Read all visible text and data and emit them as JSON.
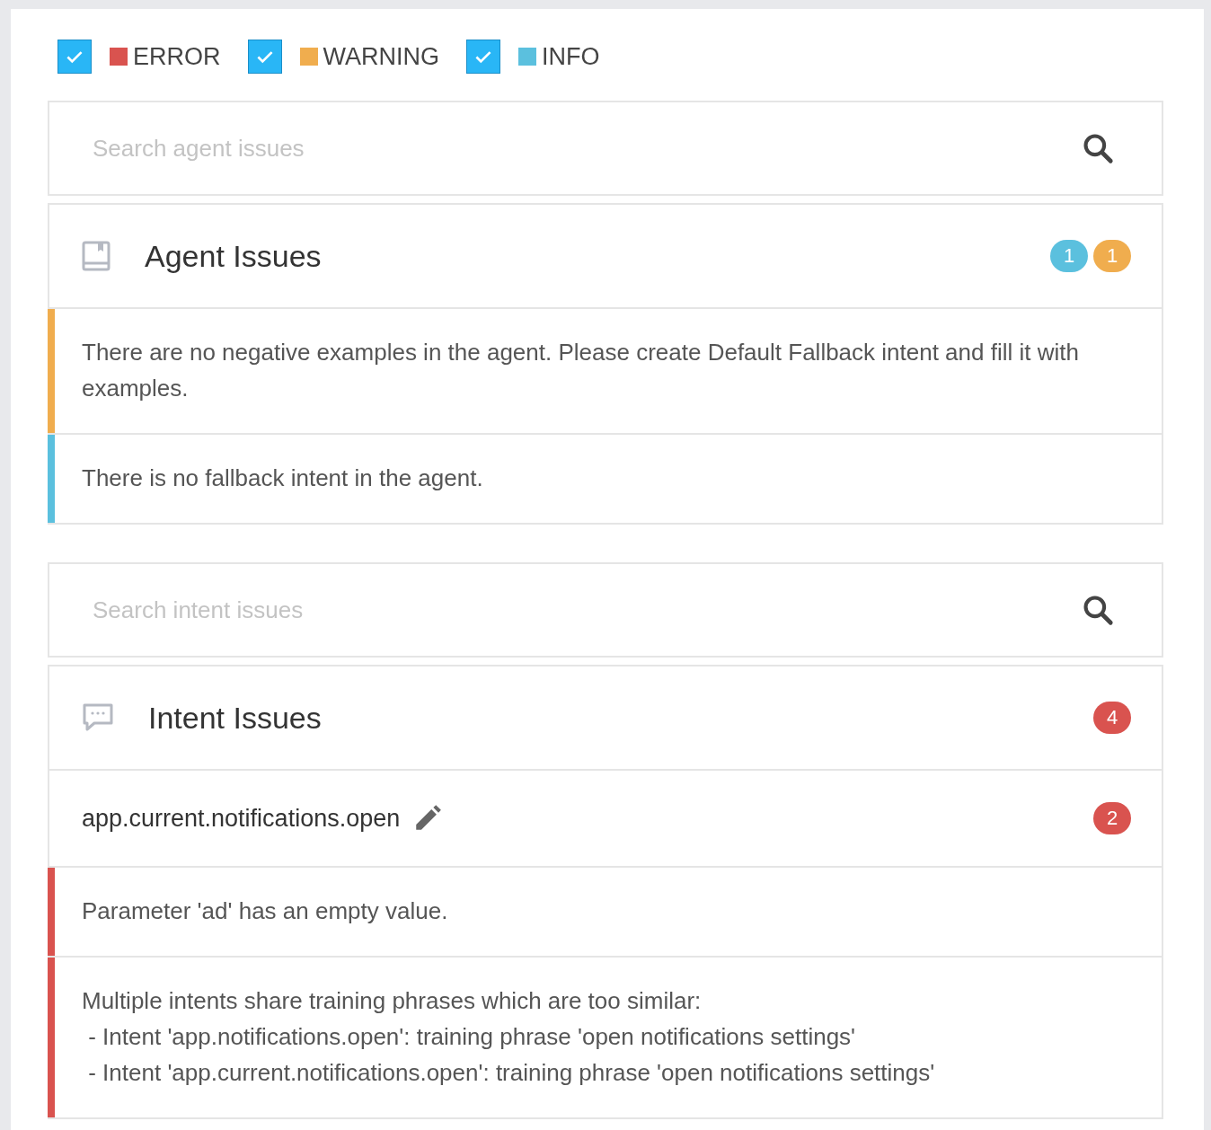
{
  "filters": [
    {
      "label": "ERROR",
      "checked": true,
      "color": "#d9534f"
    },
    {
      "label": "WARNING",
      "checked": true,
      "color": "#f0ad4e"
    },
    {
      "label": "INFO",
      "checked": true,
      "color": "#5bc0de"
    }
  ],
  "agent_search": {
    "placeholder": "Search agent issues"
  },
  "agent_section": {
    "title": "Agent Issues",
    "badges": [
      {
        "count": "1",
        "color": "#5bc0de"
      },
      {
        "count": "1",
        "color": "#f0ad4e"
      }
    ],
    "issues": [
      {
        "color": "#f0ad4e",
        "lines": [
          "There are no negative examples in the agent. Please create Default Fallback intent and fill it with examples."
        ]
      },
      {
        "color": "#5bc0de",
        "lines": [
          "There is no fallback intent in the agent."
        ]
      }
    ]
  },
  "intent_search": {
    "placeholder": "Search intent issues"
  },
  "intent_section": {
    "title": "Intent Issues",
    "badges": [
      {
        "count": "4",
        "color": "#d9534f"
      }
    ],
    "intents": [
      {
        "name": "app.current.notifications.open",
        "badges": [
          {
            "count": "2",
            "color": "#d9534f"
          }
        ],
        "issues": [
          {
            "color": "#d9534f",
            "lines": [
              "Parameter 'ad' has an empty value."
            ]
          },
          {
            "color": "#d9534f",
            "lines": [
              "Multiple intents share training phrases which are too similar:",
              " - Intent 'app.notifications.open': training phrase 'open notifications settings'",
              " - Intent 'app.current.notifications.open': training phrase 'open notifications settings'"
            ]
          }
        ]
      }
    ]
  }
}
